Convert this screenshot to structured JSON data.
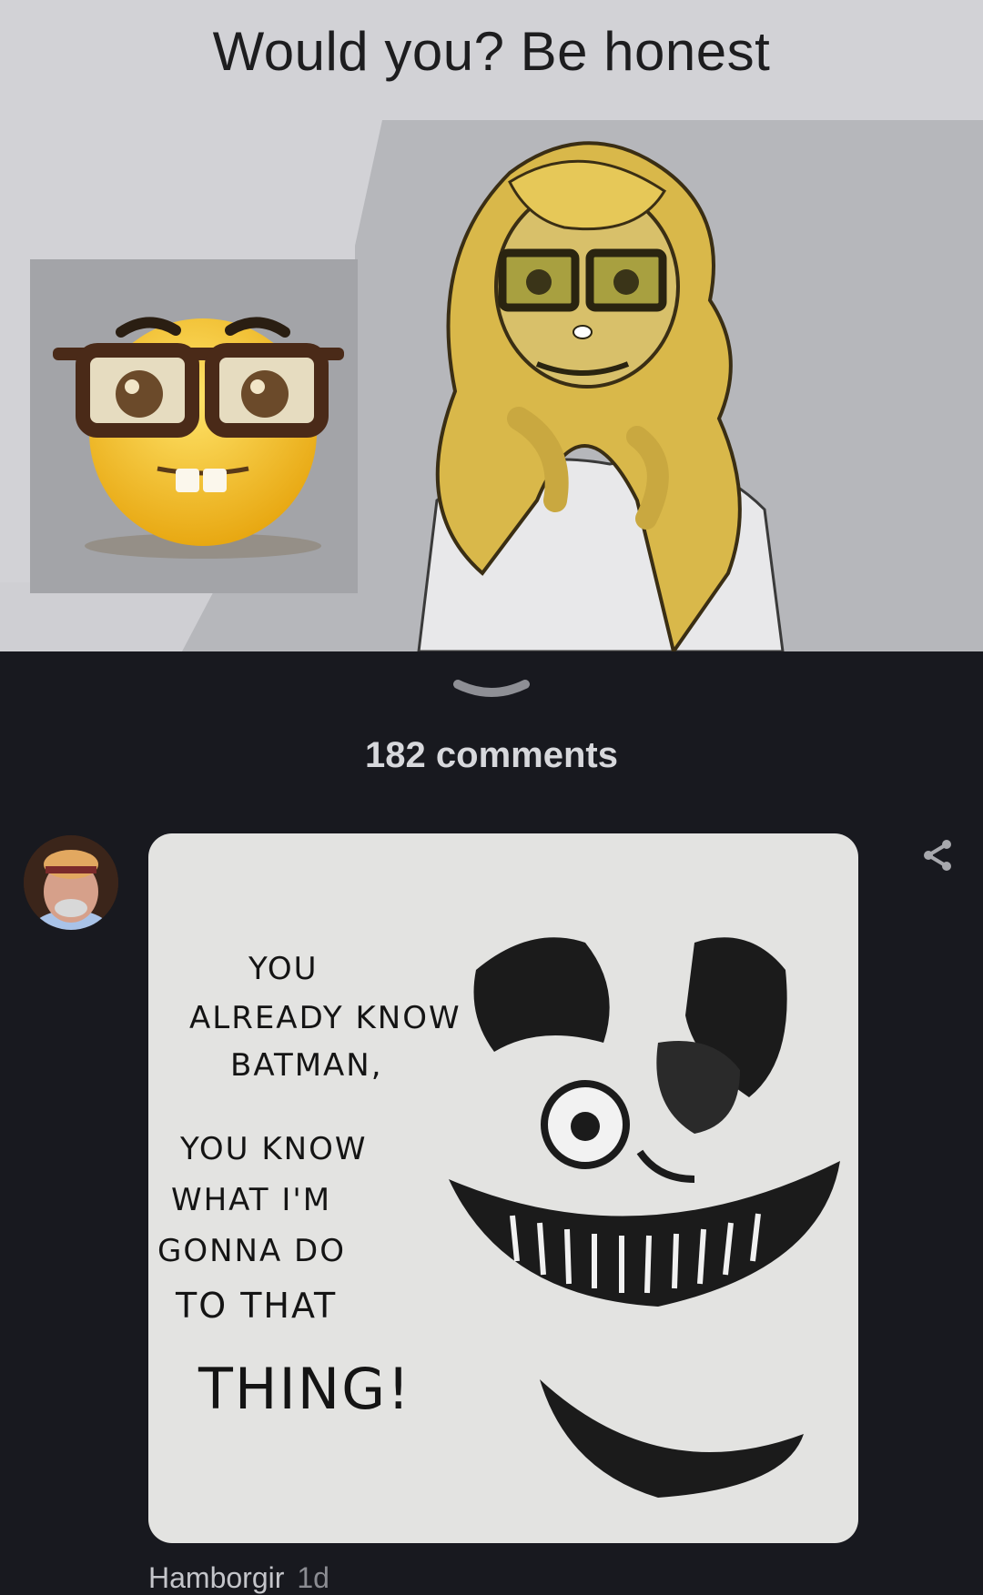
{
  "post": {
    "meme_caption": "Would you? Be honest",
    "images": [
      "nerd-face-emoji",
      "cartoon-girl-with-glasses"
    ]
  },
  "comments": {
    "count_label": "182 comments",
    "items": [
      {
        "author": "Hamborgir",
        "age": "1d",
        "image_text": {
          "line1": "YOU",
          "line2": "ALREADY KNOW",
          "line3": "BATMAN,",
          "line4": "YOU KNOW",
          "line5": "WHAT I'M",
          "line6": "GONNA DO",
          "line7": "TO THAT",
          "line8": "THING!"
        }
      }
    ]
  },
  "icons": {
    "handle": "chevron-down-icon",
    "share": "share-icon"
  },
  "colors": {
    "background": "#18191f",
    "text_primary": "#d7d8dc",
    "text_secondary": "#8b8c92"
  }
}
